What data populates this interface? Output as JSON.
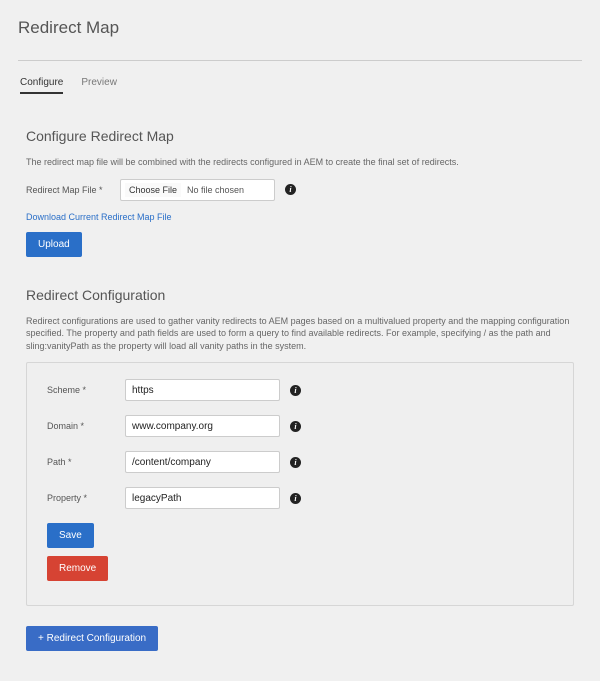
{
  "page": {
    "title": "Redirect Map"
  },
  "tabs": {
    "configure": "Configure",
    "preview": "Preview"
  },
  "configureMap": {
    "title": "Configure Redirect Map",
    "help": "The redirect map file will be combined with the redirects configured in AEM to create the final set of redirects.",
    "fileLabel": "Redirect Map File *",
    "chooseFile": "Choose File",
    "noFile": "No file chosen",
    "downloadLink": "Download Current Redirect Map File",
    "uploadBtn": "Upload"
  },
  "redirectConfig": {
    "title": "Redirect Configuration",
    "help": "Redirect configurations are used to gather vanity redirects to AEM pages based on a multivalued property and the mapping configuration specified. The property and path fields are used to form a query to find available redirects. For example, specifying / as the path and sling:vanityPath as the property will load all vanity paths in the system.",
    "scheme": {
      "label": "Scheme *",
      "value": "https"
    },
    "domain": {
      "label": "Domain *",
      "value": "www.company.org"
    },
    "path": {
      "label": "Path *",
      "value": "/content/company"
    },
    "property": {
      "label": "Property *",
      "value": "legacyPath"
    },
    "saveBtn": "Save",
    "removeBtn": "Remove",
    "addBtn": "+ Redirect Configuration"
  }
}
